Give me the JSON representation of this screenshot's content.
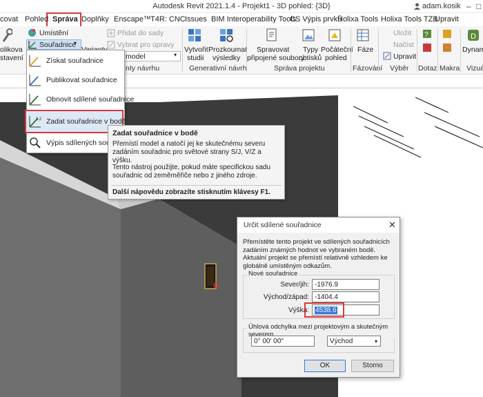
{
  "title": {
    "text": "Autodesk Revit 2021.1.4 - Projekt1 - 3D pohled: {3D}",
    "user": "adam.kosik",
    "help": "?",
    "minimize": "–",
    "maximize": "□",
    "close": "✕"
  },
  "tabs": [
    "covat",
    "Pohled",
    "Správa",
    "Doplňky",
    "Enscape™",
    "T4R: CNC",
    "Issues",
    "BIM Interoperability Tools",
    "CS Výpis prvků",
    "Holixa Tools",
    "Holixa Tools TZB",
    "Upravit"
  ],
  "ribbon": {
    "umisteni": "Umístění",
    "souradnice": "Souřadnice",
    "left_col": [
      "olikova",
      "stavení"
    ],
    "varianty": "Varianty",
    "pridat_do_sady": "Přidat do sady",
    "vybrat_pro_upravy": "Vybrat pro úpravy",
    "model_select": "model",
    "panel_varianty": "nty návrhu",
    "vytvorit_studii": [
      "Vytvořit",
      "studii"
    ],
    "prozkoumat_vysledky": [
      "Prozkoumat",
      "výsledky"
    ],
    "panel_generativni": "Generativní návrh",
    "spravovat": [
      "Spravovat",
      "připojené soubory"
    ],
    "typy_obtisku": [
      "Typy",
      "obtisků"
    ],
    "pocatecni_pohled": [
      "Počáteční",
      "pohled"
    ],
    "panel_sprava_projektu": "Správa projektu",
    "faze": "Fáze",
    "panel_fazovani": "Fázování",
    "ulozit": "Uložit",
    "nacist": "Načíst",
    "upravit": "Upravit",
    "panel_vyber": "Výběr",
    "panel_dotaz": "Dotaz",
    "panel_makra": "Makra",
    "dynamo": "Dynamo",
    "panel_vizual": "Vizuál"
  },
  "dropdown": {
    "items": [
      "Získat souřadnice",
      "Publikovat souřadnice",
      "Obnovit sdílené souřadnice",
      "Zadat souřadnice v bodě",
      "Výpis sdílených souřadnic"
    ]
  },
  "tooltip": {
    "title": "Zadat souřadnice v bodě",
    "p1": "Přemístí model a natočí jej ke skutečnému severu zadáním souřadnic pro světové strany S/J, V/Z a výšku.",
    "p2": "Tento nástroj použijte, pokud máte specifickou sadu souřadnic od zeměměřiče nebo z jiného zdroje.",
    "f1": "Další nápovědu zobrazíte stisknutím klávesy F1."
  },
  "dialog": {
    "title": "Určit sdílené souřadnice",
    "description": "Přemístěte tento projekt ve sdílených souřadnicích zadáním známých hodnot ve vybraném bodě. Aktuální projekt se přemístí relativně vzhledem ke globálně umístěným odkazům.",
    "group_new": "Nové souřadnice",
    "sever_label": "Sever/jih:",
    "sever_value": "-1976.9",
    "vychod_label": "Východ/západ:",
    "vychod_value": "-1404.4",
    "vyska_label": "Výška:",
    "vyska_value": "4538.6",
    "group_angle": "Úhlová odchylka mezi projektovým a skutečným severem",
    "angle_value": "0° 00' 00\"",
    "direction_value": "Východ",
    "ok": "OK",
    "cancel": "Storno"
  },
  "colors": {
    "highlight_red": "#d9363e",
    "selection_blue": "#3a75d6"
  }
}
